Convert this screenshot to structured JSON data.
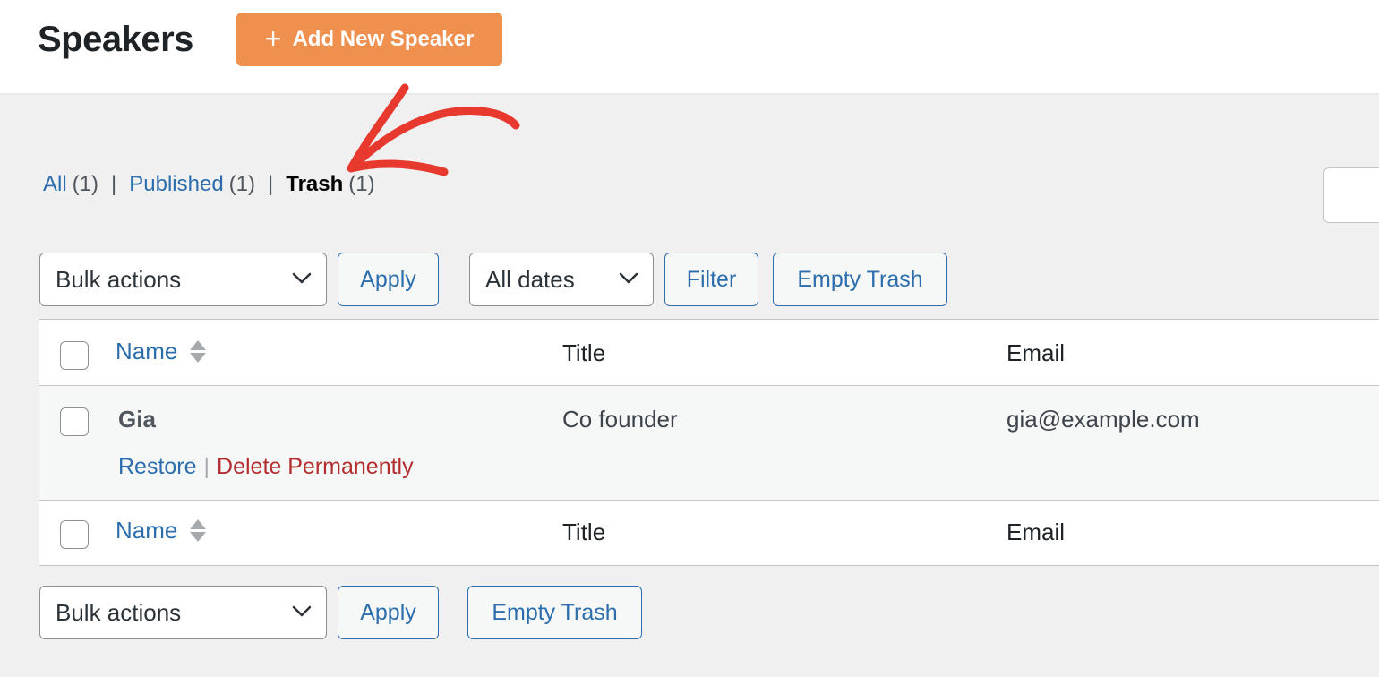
{
  "header": {
    "title": "Speakers",
    "add_button_label": "Add New Speaker"
  },
  "views": {
    "all_label": "All",
    "all_count": "(1)",
    "published_label": "Published",
    "published_count": "(1)",
    "trash_label": "Trash",
    "trash_count": "(1)",
    "separator": "|"
  },
  "top_nav": {
    "bulk_actions": "Bulk actions",
    "apply": "Apply",
    "date_filter": "All dates",
    "filter": "Filter",
    "empty_trash": "Empty Trash"
  },
  "table": {
    "columns": [
      "Name",
      "Title",
      "Email"
    ],
    "rows": [
      {
        "name": "Gia",
        "title": "Co founder",
        "email": "gia@example.com",
        "actions": {
          "restore": "Restore",
          "separator": "|",
          "delete": "Delete Permanently"
        }
      }
    ]
  },
  "bottom_nav": {
    "bulk_actions": "Bulk actions",
    "apply": "Apply",
    "empty_trash": "Empty Trash"
  },
  "colors": {
    "accent_orange": "#f0904f",
    "link_blue": "#2c6ead",
    "delete_red": "#b32d2e",
    "annotation_red": "#e8392f"
  },
  "icons": {
    "add": "plus-icon",
    "dropdown": "chevron-down-icon",
    "sort": "sort-arrows-icon",
    "annotation": "arrow-annotation-icon"
  }
}
